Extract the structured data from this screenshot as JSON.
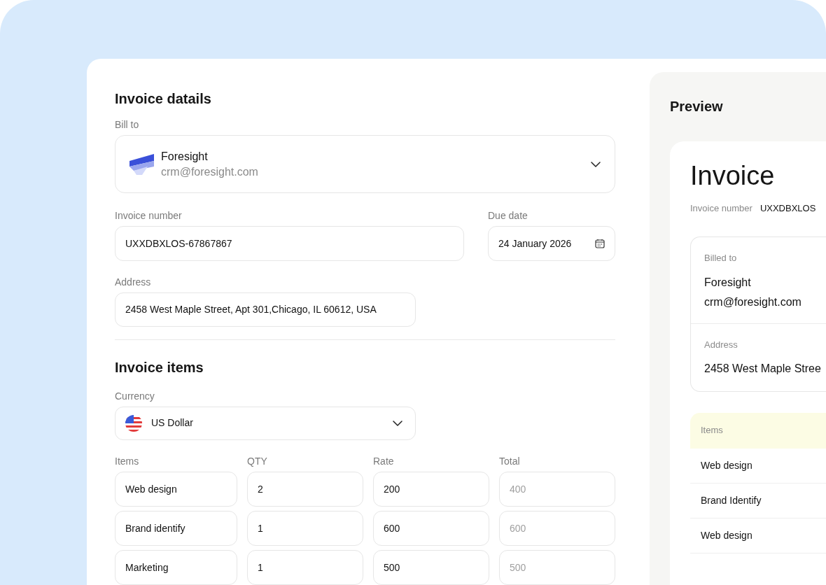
{
  "form": {
    "title": "Invoice datails",
    "bill_to": {
      "label": "Bill to",
      "name": "Foresight",
      "email": "crm@foresight.com"
    },
    "invoice_number": {
      "label": "Invoice number",
      "value": "UXXDBXLOS-67867867"
    },
    "due_date": {
      "label": "Due date",
      "value": "24 January 2026"
    },
    "address": {
      "label": "Address",
      "value": "2458 West Maple Street, Apt 301,Chicago, IL 60612, USA"
    }
  },
  "items_section": {
    "title": "Invoice items",
    "currency": {
      "label": "Currency",
      "value": "US Dollar"
    },
    "columns": [
      "Items",
      "QTY",
      "Rate",
      "Total"
    ],
    "rows": [
      {
        "item": "Web design",
        "qty": "2",
        "rate": "200",
        "total": "400"
      },
      {
        "item": "Brand identify",
        "qty": "1",
        "rate": "600",
        "total": "600"
      },
      {
        "item": "Marketing",
        "qty": "1",
        "rate": "500",
        "total": "500"
      }
    ]
  },
  "preview": {
    "title": "Preview",
    "heading": "Invoice",
    "number_label": "Invoice number",
    "number_value": "UXXDBXLOS",
    "billed_label": "Billed to",
    "billed_name": "Foresight",
    "billed_email": "crm@foresight.com",
    "address_label": "Address",
    "address_value": "2458 West Maple Stree",
    "items_header": "Items",
    "items": [
      "Web design",
      "Brand Identify",
      "Web design"
    ]
  }
}
